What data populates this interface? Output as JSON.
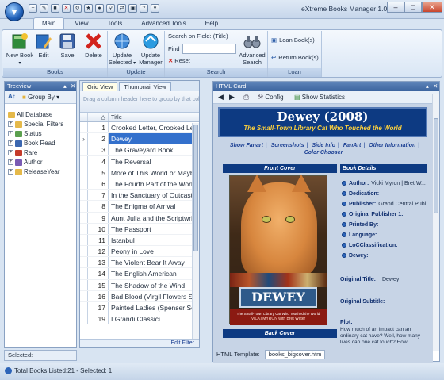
{
  "app": {
    "title": "eXtreme Books Manager 1.0.1.0 (ex..."
  },
  "ribbon_tabs": [
    "Main",
    "View",
    "Tools",
    "Advanced Tools",
    "Help"
  ],
  "ribbon": {
    "books": {
      "label": "Books",
      "new_book": "New Book",
      "edit": "Edit",
      "save": "Save",
      "delete": "Delete"
    },
    "update": {
      "label": "Update",
      "update_selected": "Update Selected",
      "update_manager": "Update Manager"
    },
    "search": {
      "label": "Search",
      "search_on_field": "Search on Field: (Title)",
      "find": "Find",
      "reset": "Reset",
      "advanced": "Advanced Search"
    },
    "loan": {
      "label": "Loan",
      "loan_books": "Loan Book(s)",
      "return_books": "Return Book(s)"
    }
  },
  "treeview": {
    "title": "Treeview",
    "group_by": "Group By",
    "items": [
      "All Database",
      "Special Filters",
      "Status",
      "Book Read",
      "Rare",
      "Author",
      "ReleaseYear"
    ],
    "selected": "Selected:"
  },
  "grid": {
    "tabs": [
      "Grid View",
      "Thumbnail View"
    ],
    "group_hint": "Drag a column header here to group by that column",
    "col_title": "Title",
    "edit_filter": "Edit Filter",
    "rows": [
      {
        "n": "1",
        "title": "Crooked Letter, Crooked Letter"
      },
      {
        "n": "2",
        "title": "Dewey"
      },
      {
        "n": "3",
        "title": "The Graveyard Book"
      },
      {
        "n": "4",
        "title": "The Reversal"
      },
      {
        "n": "5",
        "title": "More of This World or Maybe Another"
      },
      {
        "n": "6",
        "title": "The Fourth Part of the World"
      },
      {
        "n": "7",
        "title": "In the Sanctuary of Outcasts"
      },
      {
        "n": "8",
        "title": "The Enigma of Arrival"
      },
      {
        "n": "9",
        "title": "Aunt Julia and the Scriptwriter"
      },
      {
        "n": "10",
        "title": "The Passport"
      },
      {
        "n": "11",
        "title": "Istanbul"
      },
      {
        "n": "12",
        "title": "Peony in Love"
      },
      {
        "n": "13",
        "title": "The Violent Bear It Away"
      },
      {
        "n": "14",
        "title": "The English American"
      },
      {
        "n": "15",
        "title": "The Shadow of the Wind"
      },
      {
        "n": "16",
        "title": "Bad Blood (Virgil Flowers Series)"
      },
      {
        "n": "17",
        "title": "Painted Ladies (Spenser Series)"
      },
      {
        "n": "19",
        "title": "I Grandi Classici"
      }
    ],
    "selected_row": 1
  },
  "card": {
    "panel_title": "HTML Card",
    "config": "Config",
    "show_statistics": "Show Statistics",
    "book_title": "Dewey (2008)",
    "subtitle": "The Small-Town Library Cat Who Touched the World",
    "links": [
      "Show Fanart",
      "Screenshots",
      "Side Info",
      "FanArt",
      "Other Information",
      "Color Chooser"
    ],
    "front_cover": "Front Cover",
    "back_cover": "Back Cover",
    "book_details": "Book Details",
    "cover_title": "DEWEY",
    "cover_sub": "The Small-Town Library Cat Who Touched the World",
    "cover_author": "VICKI MYRON with Bret Witter",
    "details": [
      {
        "label": "Author:",
        "value": "Vicki Myron | Bret W..."
      },
      {
        "label": "Dedication:",
        "value": ""
      },
      {
        "label": "Publisher:",
        "value": "Grand Central Publ..."
      },
      {
        "label": "Original Publisher 1:",
        "value": ""
      },
      {
        "label": "Printed By:",
        "value": ""
      },
      {
        "label": "Language:",
        "value": ""
      },
      {
        "label": "LoCClassification:",
        "value": ""
      },
      {
        "label": "Dewey:",
        "value": ""
      }
    ],
    "original_title_label": "Original Title:",
    "original_title_value": "Dewey",
    "original_subtitle_label": "Original Subtitle:",
    "plot_label": "Plot:",
    "plot_text": "How much of an impact can an ordinary cat have? Well, how many lives can one cat touch? How...",
    "template_label": "HTML Template:",
    "template_value": "books_bigcover.htm"
  },
  "status": {
    "text": "Total Books Listed:21 - Selected: 1"
  }
}
